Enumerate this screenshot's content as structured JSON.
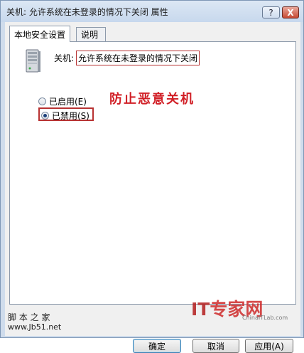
{
  "window": {
    "title": "关机: 允许系统在未登录的情况下关闭 属性",
    "help_label": "?",
    "close_label": "X"
  },
  "tabs": [
    {
      "label": "本地安全设置",
      "active": true
    },
    {
      "label": "说明",
      "active": false
    }
  ],
  "policy": {
    "label": "关机:",
    "name": "允许系统在未登录的情况下关闭"
  },
  "annotation": "防止恶意关机",
  "options": [
    {
      "label": "已启用(E)",
      "checked": false
    },
    {
      "label": "已禁用(S)",
      "checked": true
    }
  ],
  "buttons": {
    "ok": "确定",
    "cancel": "取消",
    "apply": "应用(A)"
  },
  "watermarks": {
    "left_line1": "脚 本 之 家",
    "left_line2": "www.Jb51.net",
    "right_brand_it": "IT",
    "right_brand_rest": "专家网",
    "right_sub": "ChinaITLab.com"
  },
  "colors": {
    "highlight_border": "#b83232",
    "annotation": "#d11f26"
  }
}
